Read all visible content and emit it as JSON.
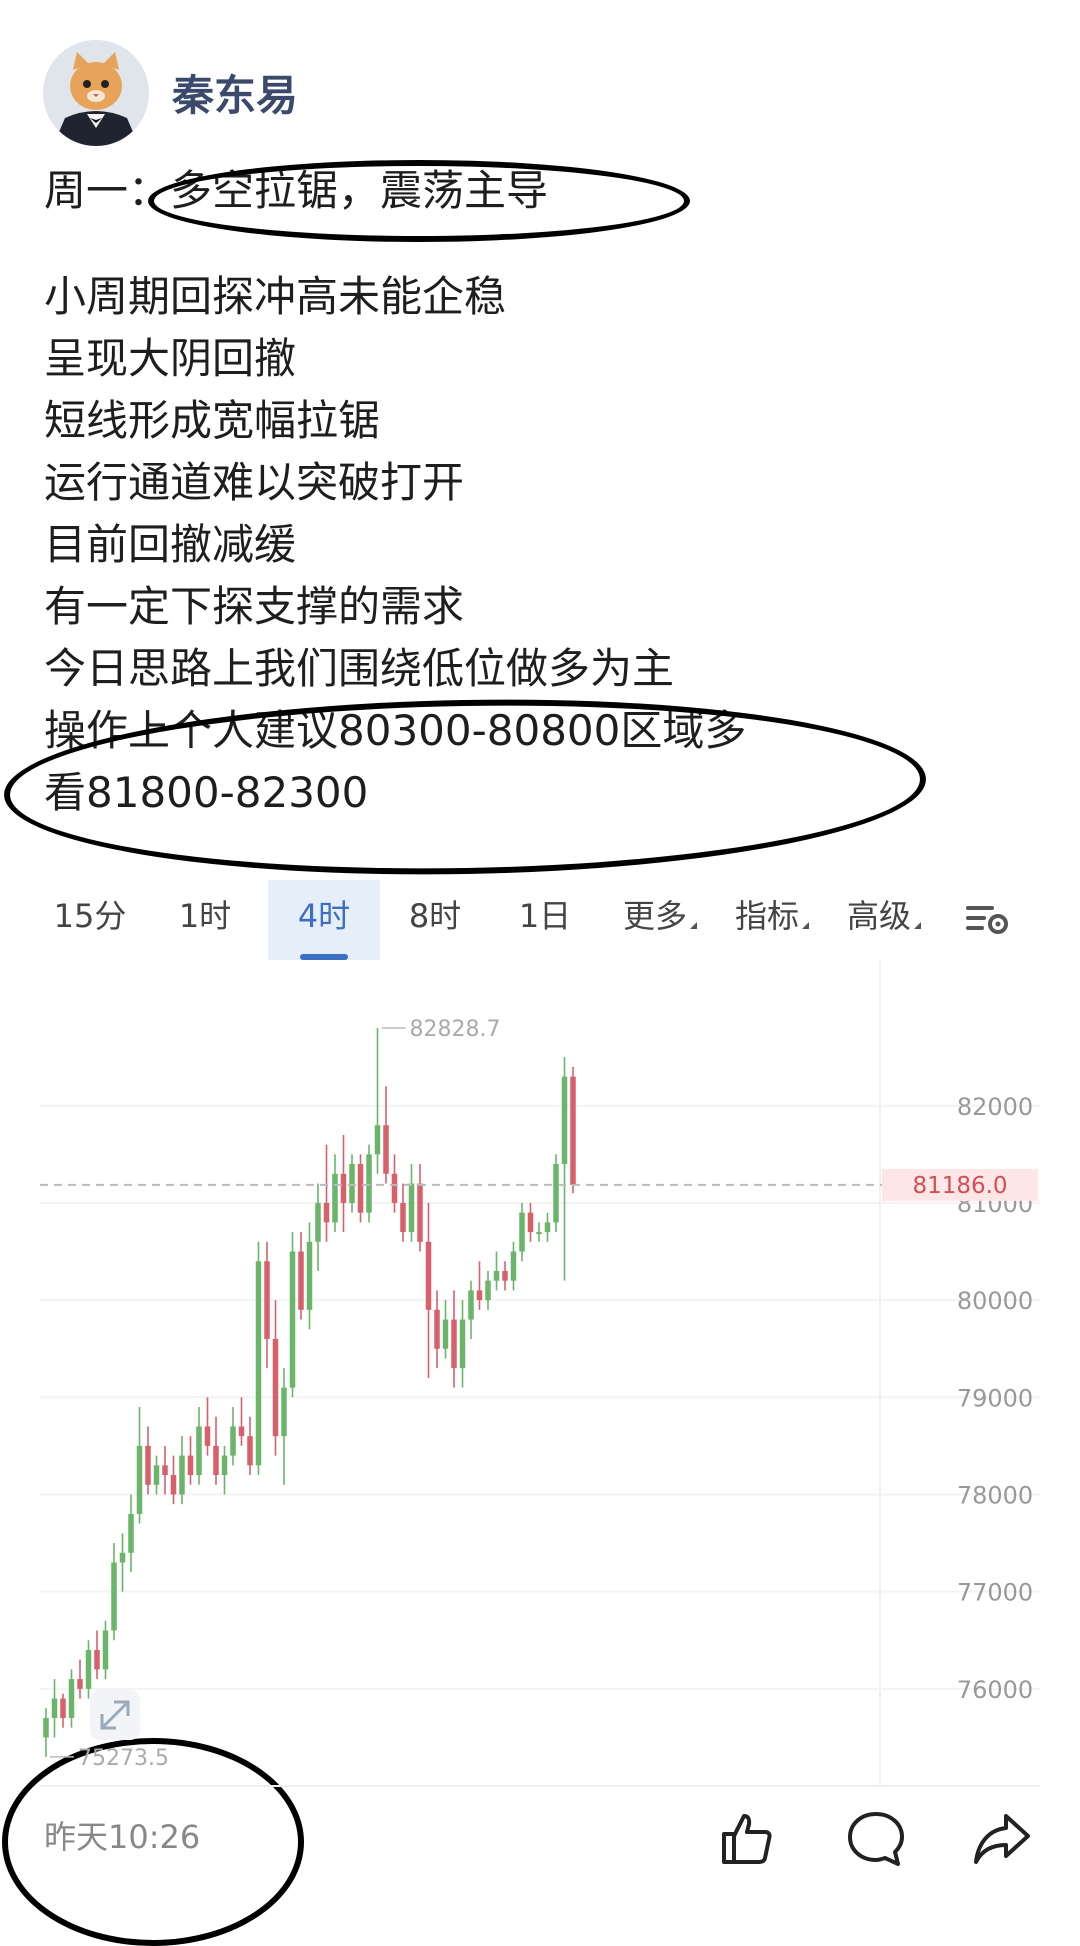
{
  "author": {
    "name": "秦东易",
    "avatar": "cat-in-suit-avatar"
  },
  "post": {
    "lines": [
      "周一：多空拉锯，震荡主导",
      "",
      "小周期回探冲高未能企稳",
      "呈现大阴回撤",
      "短线形成宽幅拉锯",
      "运行通道难以突破打开",
      "目前回撤减缓",
      "有一定下探支撑的需求",
      "今日思路上我们围绕低位做多为主",
      "操作上个人建议80300-80800区域多",
      "看81800-82300"
    ]
  },
  "tabs": [
    {
      "label": "15分"
    },
    {
      "label": "1时"
    },
    {
      "label": "4时",
      "active": true
    },
    {
      "label": "8时"
    },
    {
      "label": "1日"
    },
    {
      "label": "更多",
      "dropdown": true
    },
    {
      "label": "指标",
      "dropdown": true
    },
    {
      "label": "高级",
      "dropdown": true
    }
  ],
  "settings_icon": "chart-settings-icon",
  "chart_data": {
    "type": "candlestick",
    "yticks": [
      "82000",
      "81000",
      "80000",
      "79000",
      "78000",
      "77000",
      "76000"
    ],
    "ylim": [
      75000,
      83500
    ],
    "high_label": "82828.7",
    "low_label": "75273.5",
    "current_price": "81186.0",
    "colors": {
      "up": "#6ab56a",
      "down": "#d9606a"
    },
    "series": {
      "name": "",
      "candles": [
        [
          75500,
          75800,
          75300,
          75700
        ],
        [
          75700,
          76100,
          75500,
          75900
        ],
        [
          75900,
          75950,
          75600,
          75700
        ],
        [
          75700,
          76200,
          75600,
          76100
        ],
        [
          76100,
          76300,
          75900,
          76000
        ],
        [
          76000,
          76500,
          75900,
          76400
        ],
        [
          76400,
          76600,
          76100,
          76200
        ],
        [
          76200,
          76700,
          76100,
          76600
        ],
        [
          76600,
          77500,
          76500,
          77300
        ],
        [
          77300,
          77600,
          77000,
          77400
        ],
        [
          77400,
          78000,
          77200,
          77800
        ],
        [
          77800,
          78900,
          77700,
          78500
        ],
        [
          78500,
          78700,
          78000,
          78100
        ],
        [
          78100,
          78400,
          78000,
          78300
        ],
        [
          78300,
          78500,
          78000,
          78200
        ],
        [
          78200,
          78400,
          77900,
          78000
        ],
        [
          78000,
          78600,
          77900,
          78400
        ],
        [
          78400,
          78600,
          78100,
          78200
        ],
        [
          78200,
          78900,
          78100,
          78700
        ],
        [
          78700,
          79000,
          78400,
          78500
        ],
        [
          78500,
          78800,
          78100,
          78200
        ],
        [
          78200,
          78500,
          78000,
          78400
        ],
        [
          78400,
          78900,
          78300,
          78700
        ],
        [
          78700,
          79000,
          78500,
          78600
        ],
        [
          78600,
          78800,
          78200,
          78300
        ],
        [
          78300,
          80600,
          78200,
          80400
        ],
        [
          80400,
          80600,
          79300,
          79600
        ],
        [
          79600,
          80000,
          78400,
          78600
        ],
        [
          78600,
          79300,
          78100,
          79100
        ],
        [
          79100,
          80700,
          79000,
          80500
        ],
        [
          80500,
          80700,
          79800,
          79900
        ],
        [
          79900,
          80800,
          79700,
          80600
        ],
        [
          80600,
          81200,
          80300,
          81000
        ],
        [
          81000,
          81600,
          80600,
          80800
        ],
        [
          80800,
          81500,
          80700,
          81300
        ],
        [
          81300,
          81700,
          80700,
          81000
        ],
        [
          81000,
          81500,
          80900,
          81400
        ],
        [
          81400,
          81500,
          80800,
          80900
        ],
        [
          80900,
          81600,
          80800,
          81500
        ],
        [
          81500,
          82800,
          81300,
          81800
        ],
        [
          81800,
          82200,
          81200,
          81300
        ],
        [
          81300,
          81500,
          80900,
          81000
        ],
        [
          81000,
          81200,
          80600,
          80700
        ],
        [
          80700,
          81400,
          80600,
          81200
        ],
        [
          81200,
          81400,
          80500,
          80600
        ],
        [
          80600,
          81000,
          79200,
          79900
        ],
        [
          79900,
          80100,
          79300,
          79500
        ],
        [
          79500,
          80000,
          79400,
          79800
        ],
        [
          79800,
          80100,
          79100,
          79300
        ],
        [
          79300,
          80000,
          79100,
          79800
        ],
        [
          79800,
          80200,
          79600,
          80100
        ],
        [
          80100,
          80400,
          79900,
          80000
        ],
        [
          80000,
          80300,
          79900,
          80200
        ],
        [
          80200,
          80500,
          80100,
          80300
        ],
        [
          80300,
          80400,
          80100,
          80200
        ],
        [
          80200,
          80600,
          80100,
          80500
        ],
        [
          80500,
          81000,
          80400,
          80900
        ],
        [
          80900,
          81000,
          80600,
          80700
        ],
        [
          80700,
          80800,
          80600,
          80700
        ],
        [
          80700,
          80900,
          80600,
          80800
        ],
        [
          80800,
          81500,
          80700,
          81400
        ],
        [
          81400,
          82500,
          80200,
          82300
        ],
        [
          82300,
          82400,
          81100,
          81186
        ]
      ]
    }
  },
  "footer": {
    "time": "昨天10:26",
    "actions": [
      "like-icon",
      "comment-icon",
      "share-icon"
    ]
  }
}
